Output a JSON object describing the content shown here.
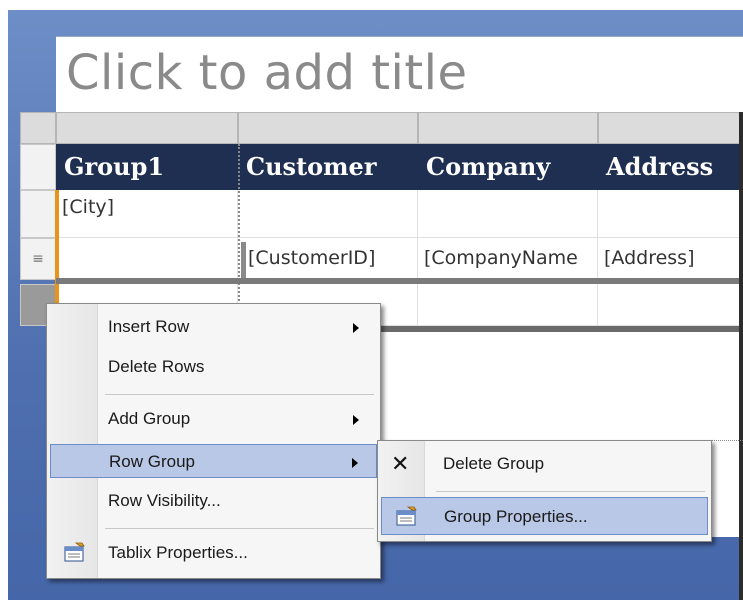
{
  "title_placeholder": "Click to add title",
  "tablix": {
    "headers": [
      "Group1",
      "Customer",
      "Company",
      "Address"
    ],
    "group_row": {
      "group1": "[City]"
    },
    "detail_row": {
      "customer": "[CustomerID]",
      "company": "[CompanyName",
      "address": "[Address]"
    },
    "row_handle_glyph": "≡"
  },
  "context_menu": {
    "items": [
      {
        "label": "Insert Row",
        "submenu": true
      },
      {
        "label": "Delete Rows",
        "submenu": false
      },
      {
        "label": "Add Group",
        "submenu": true
      },
      {
        "label": "Row Group",
        "submenu": true,
        "highlighted": true
      },
      {
        "label": "Row Visibility...",
        "submenu": false
      },
      {
        "label": "Tablix Properties...",
        "submenu": false,
        "icon": "properties-icon"
      }
    ]
  },
  "submenu": {
    "items": [
      {
        "label": "Delete Group",
        "icon": "delete-x-icon"
      },
      {
        "label": "Group Properties...",
        "icon": "properties-icon",
        "highlighted": true
      }
    ]
  },
  "colors": {
    "background": "#5577b5",
    "header_fill": "#1f2f52",
    "group_bar": "#e8941c",
    "menu_highlight": "#b9c8e6"
  }
}
